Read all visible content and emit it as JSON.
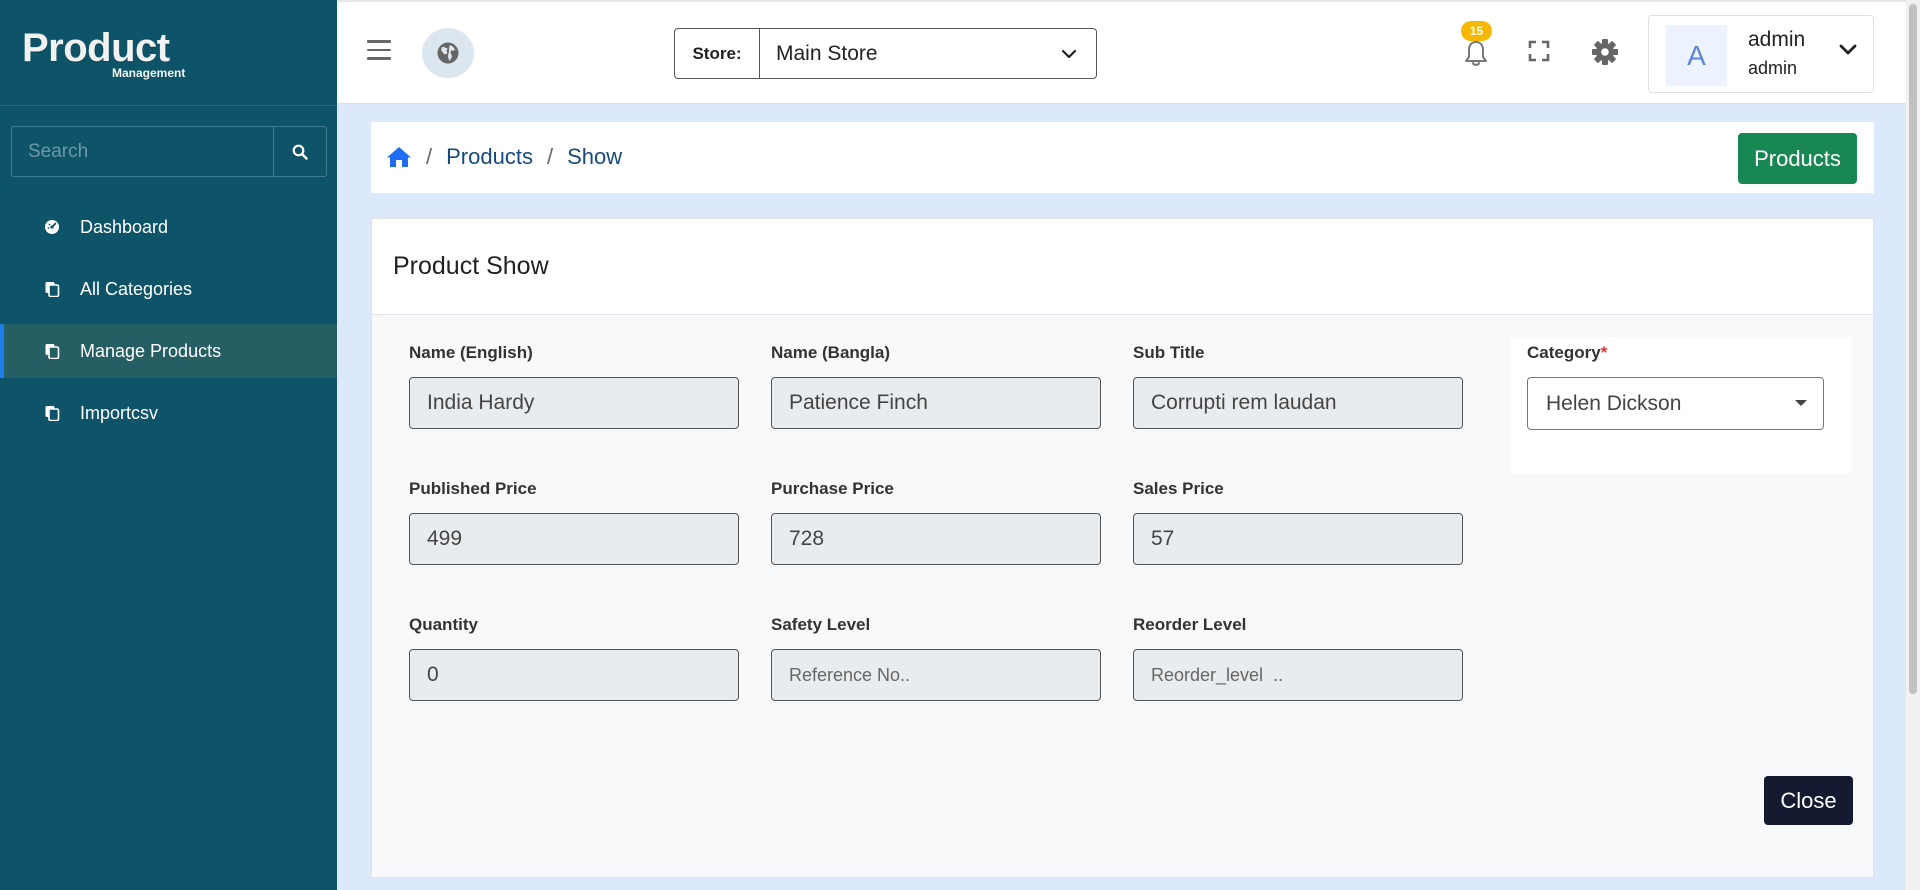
{
  "sidebar": {
    "logo": {
      "title": "Product",
      "subtitle": "Management"
    },
    "search": {
      "placeholder": "Search"
    },
    "items": [
      {
        "label": "Dashboard",
        "icon": "dashboard-icon",
        "active": false
      },
      {
        "label": "All Categories",
        "icon": "copy-icon",
        "active": false
      },
      {
        "label": "Manage Products",
        "icon": "copy-icon",
        "active": true
      },
      {
        "label": "Importcsv",
        "icon": "copy-icon",
        "active": false
      }
    ]
  },
  "header": {
    "store": {
      "label": "Store:",
      "value": "Main Store"
    },
    "notifications": {
      "count": "15"
    },
    "user": {
      "avatar": "A",
      "name": "admin",
      "role": "admin"
    }
  },
  "breadcrumb": {
    "items": [
      "Products",
      "Show"
    ],
    "separator": "/",
    "action_label": "Products"
  },
  "card": {
    "title": "Product Show",
    "fields": {
      "name_en": {
        "label": "Name (English)",
        "value": "India Hardy",
        "placeholder": ""
      },
      "name_bn": {
        "label": "Name (Bangla)",
        "value": "Patience Finch",
        "placeholder": ""
      },
      "sub_title": {
        "label": "Sub Title",
        "value": "Corrupti rem laudan",
        "placeholder": ""
      },
      "published_price": {
        "label": "Published Price",
        "value": "499",
        "placeholder": ""
      },
      "purchase_price": {
        "label": "Purchase Price",
        "value": "728",
        "placeholder": ""
      },
      "sales_price": {
        "label": "Sales Price",
        "value": "57",
        "placeholder": ""
      },
      "quantity": {
        "label": "Quantity",
        "value": "0",
        "placeholder": ""
      },
      "safety_level": {
        "label": "Safety Level",
        "value": "",
        "placeholder": "Reference No.."
      },
      "reorder_level": {
        "label": "Reorder Level",
        "value": "",
        "placeholder": "Reorder_level  .."
      }
    },
    "category": {
      "label": "Category",
      "required_mark": "*",
      "value": "Helen Dickson"
    },
    "close_label": "Close"
  },
  "colors": {
    "sidebar_bg": "#0e5468",
    "active_item": "#265f63",
    "active_accent": "#1d7eea",
    "primary_success": "#198754",
    "close_button": "#141a30",
    "badge": "#f5b700",
    "page_bg": "#dce9fa"
  }
}
